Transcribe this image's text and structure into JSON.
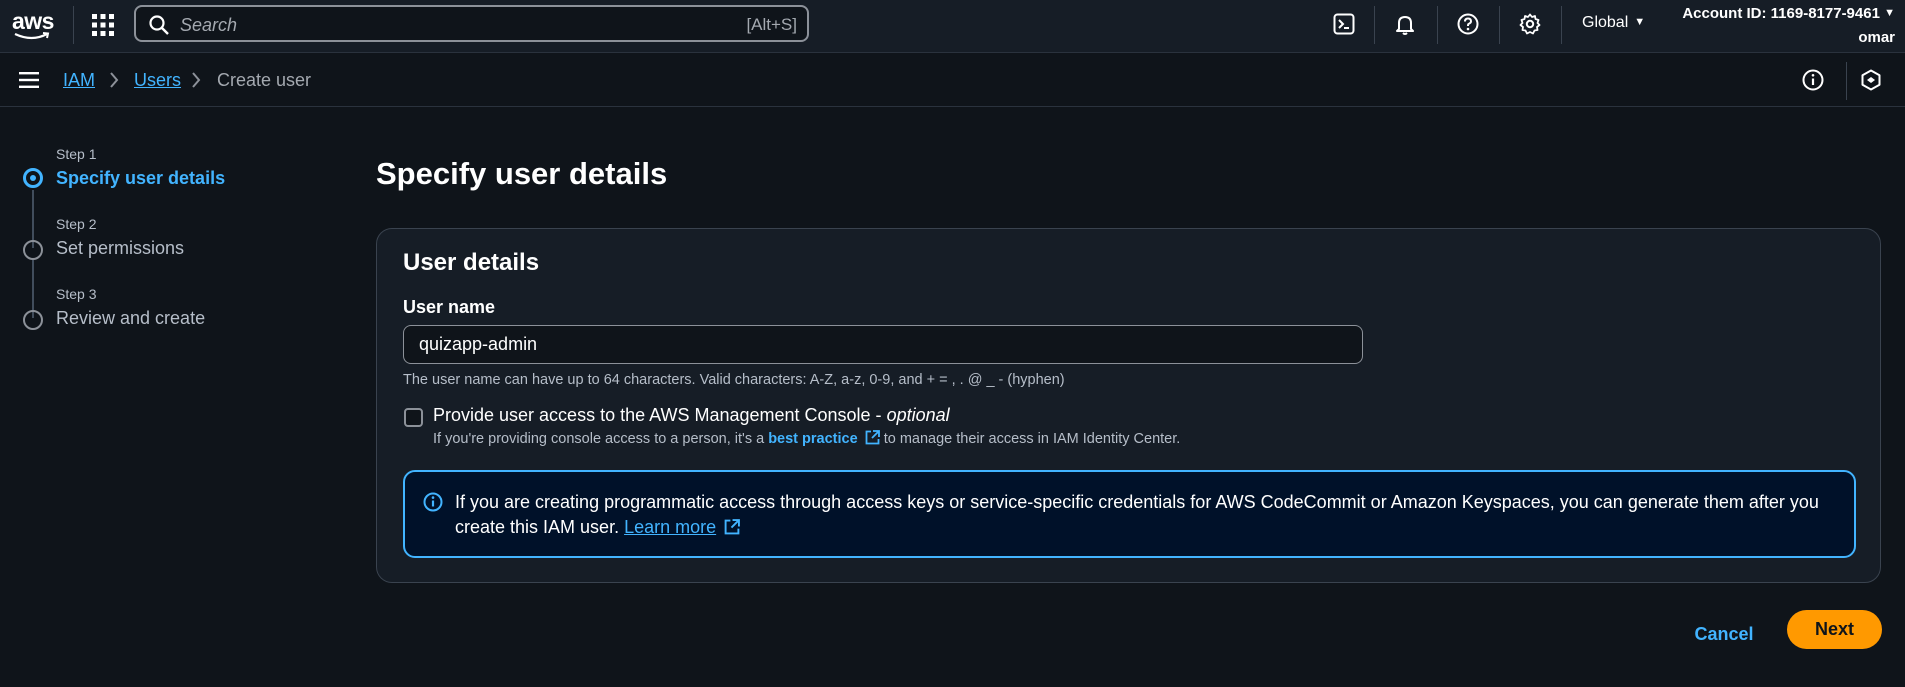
{
  "topnav": {
    "logo_text": "aws",
    "search_placeholder": "Search",
    "search_shortcut": "[Alt+S]",
    "region": "Global",
    "account_id": "Account ID: 1169-8177-9461",
    "username": "omar"
  },
  "breadcrumb": {
    "items": [
      "IAM",
      "Users",
      "Create user"
    ]
  },
  "steps": [
    {
      "num": "Step 1",
      "label": "Specify user details",
      "active": true
    },
    {
      "num": "Step 2",
      "label": "Set permissions",
      "active": false
    },
    {
      "num": "Step 3",
      "label": "Review and create",
      "active": false
    }
  ],
  "page": {
    "title": "Specify user details",
    "panel_title": "User details",
    "username_label": "User name",
    "username_value": "quizapp-admin",
    "constraint": "The user name can have up to 64 characters. Valid characters: A-Z, a-z, 0-9, and + = , . @ _ - (hyphen)",
    "console_access_label": "Provide user access to the AWS Management Console - ",
    "console_access_optional": "optional",
    "console_desc_pre": "If you're providing console access to a person, it's a ",
    "console_desc_link": "best practice",
    "console_desc_post": " to manage their access in IAM Identity Center.",
    "info_text": "If you are creating programmatic access through access keys or service-specific credentials for AWS CodeCommit or Amazon Keyspaces, you can generate them after you create this IAM user. ",
    "info_link": "Learn more"
  },
  "actions": {
    "cancel": "Cancel",
    "next": "Next"
  },
  "colors": {
    "accent": "#42b4ff",
    "primary_button": "#ff9900",
    "background": "#0f141a"
  }
}
